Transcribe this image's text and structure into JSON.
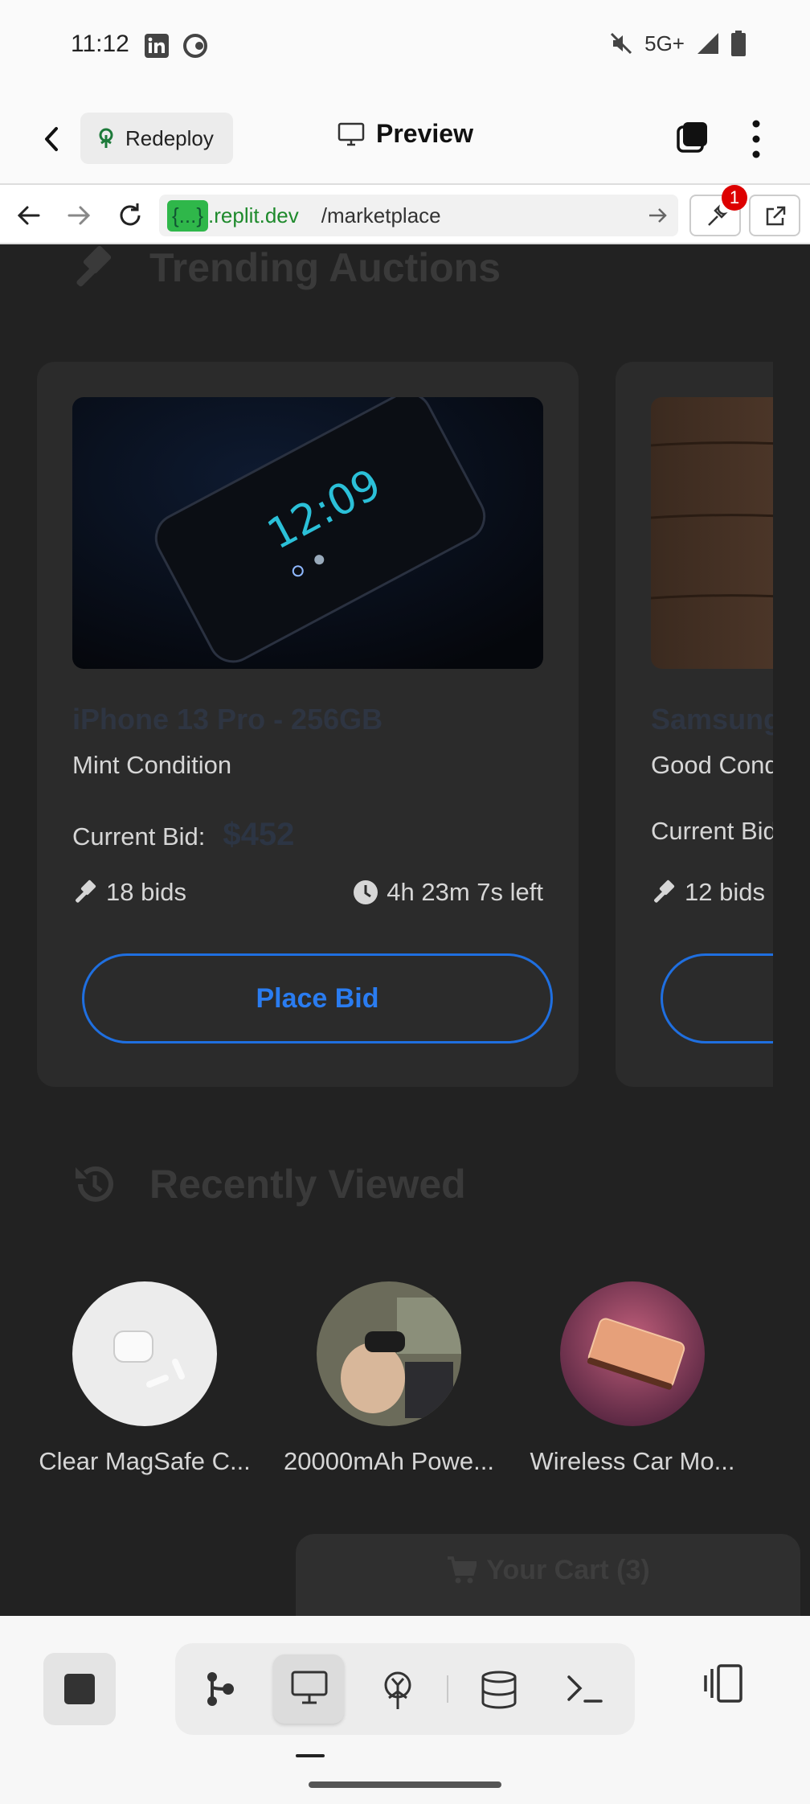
{
  "status_bar": {
    "time": "11:12",
    "network": "5G+",
    "icons": [
      "linkedin-icon",
      "app-icon",
      "mute-icon",
      "signal-icon",
      "battery-icon"
    ]
  },
  "header": {
    "back_icon": "chevron-left-icon",
    "redeploy_label": "Redeploy",
    "preview_label": "Preview",
    "tabs_icon": "tabs-icon",
    "menu_icon": "kebab-icon"
  },
  "browser": {
    "url_host": "{...}",
    "url_domain": ".replit.dev",
    "url_path": "/marketplace",
    "devtools_badge": "1"
  },
  "page": {
    "trending_title": "Trending Auctions",
    "recent_title": "Recently Viewed",
    "current_bid_label": "Current Bid:",
    "place_bid_label": "Place Bid",
    "auctions": [
      {
        "title": "iPhone 13 Pro - 256GB",
        "condition": "Mint Condition",
        "price": "$452",
        "bids": "18 bids",
        "time_left": "4h 23m 7s left"
      },
      {
        "title": "Samsung",
        "condition": "Good Cond",
        "bid_label": "Current Bid",
        "bids": "12 bids"
      }
    ],
    "recently_viewed": [
      {
        "label": "Clear MagSafe C..."
      },
      {
        "label": "20000mAh Powe..."
      },
      {
        "label": "Wireless Car Mo..."
      }
    ],
    "cart_label": "Your Cart (3)"
  },
  "toolbar": {
    "icons": [
      "stop-icon",
      "git-icon",
      "preview-icon",
      "deploy-icon",
      "database-icon",
      "shell-icon",
      "panels-icon"
    ]
  }
}
